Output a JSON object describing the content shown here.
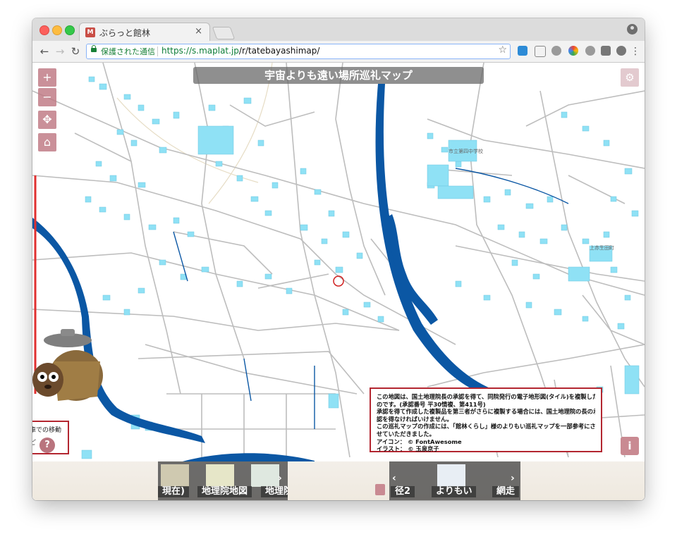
{
  "browser": {
    "tab_title": "ぶらっと館林",
    "tab_favicon": "M",
    "tab_close": "×",
    "secure_label": "保護された通信",
    "url_host": "https://s.maplat.jp",
    "url_path": "/r/tatebayashimap/",
    "icons": [
      "back-icon",
      "forward-icon",
      "reload-icon",
      "lock-icon",
      "star-icon",
      "profile-icon"
    ]
  },
  "map": {
    "title": "宇宙よりも遠い場所巡礼マップ",
    "controls": {
      "zoom_in": "+",
      "zoom_out": "−",
      "locate": "✥",
      "home": "⌂"
    },
    "gear": "⚙",
    "help": "?",
    "info": "i",
    "colors": {
      "river": "#0b57a4",
      "buildings": "#8fe1f5",
      "roads": "#bdbdbd",
      "accent": "#b32630",
      "button": "#c98a92"
    }
  },
  "attribution": {
    "lines": [
      "この地図は、国土地理院長の承認を得て、同院発行の電子地形図(タイル)を複製したも",
      "のです。(承認番号 平30情複、第411号)",
      "承認を得て作成した複製品を第三者がさらに複製する場合には、国土地理院の長の承",
      "認を得なければいけません。",
      "この巡礼マップの作成には、「館林くらし」様のよりもい巡礼マップを一部参考にさ",
      "せていただきました。",
      "アイコン： © FontAwesome",
      "イラスト： © 玉泉京子"
    ]
  },
  "left_panel": {
    "line1": "車での移動",
    "line2": "ど"
  },
  "carousel_left": {
    "items": [
      "現在)",
      "地理院地図",
      "地理院"
    ],
    "arrow": "›"
  },
  "carousel_right": {
    "items": [
      "径2",
      "よりもい",
      "網走"
    ],
    "arrow_left": "‹",
    "arrow_right": "›"
  }
}
